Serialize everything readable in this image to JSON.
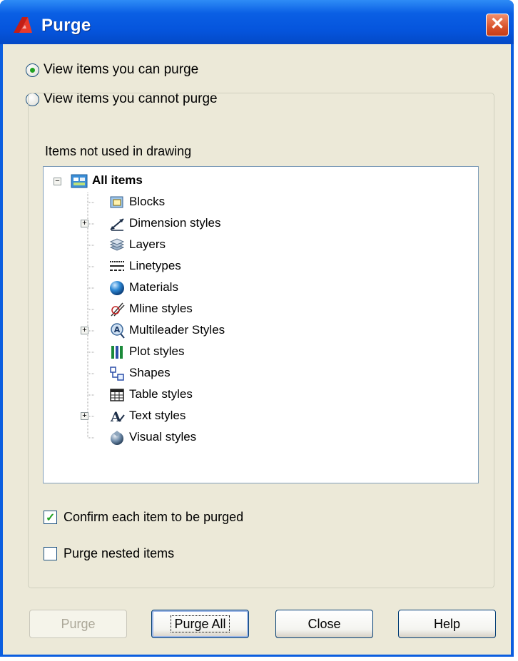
{
  "window": {
    "title": "Purge",
    "close_glyph": "✕",
    "app_icon": "autocad-logo-icon"
  },
  "view_options": [
    {
      "label": "View items you can purge",
      "selected": true
    },
    {
      "label": "View items you cannot purge",
      "selected": false
    }
  ],
  "tree": {
    "group_label": "Items not used in drawing",
    "root": {
      "label": "All items",
      "expanded": true,
      "icon": "all-items-icon"
    },
    "items": [
      {
        "label": "Blocks",
        "icon": "blocks-icon",
        "expandable": false
      },
      {
        "label": "Dimension styles",
        "icon": "dimension-styles-icon",
        "expandable": true
      },
      {
        "label": "Layers",
        "icon": "layers-icon",
        "expandable": false
      },
      {
        "label": "Linetypes",
        "icon": "linetypes-icon",
        "expandable": false
      },
      {
        "label": "Materials",
        "icon": "materials-icon",
        "expandable": false
      },
      {
        "label": "Mline styles",
        "icon": "mline-styles-icon",
        "expandable": false
      },
      {
        "label": "Multileader Styles",
        "icon": "multileader-styles-icon",
        "expandable": true
      },
      {
        "label": "Plot styles",
        "icon": "plot-styles-icon",
        "expandable": false
      },
      {
        "label": "Shapes",
        "icon": "shapes-icon",
        "expandable": false
      },
      {
        "label": "Table styles",
        "icon": "table-styles-icon",
        "expandable": false
      },
      {
        "label": "Text styles",
        "icon": "text-styles-icon",
        "expandable": true
      },
      {
        "label": "Visual styles",
        "icon": "visual-styles-icon",
        "expandable": false
      }
    ]
  },
  "options": {
    "confirm": {
      "label": "Confirm each item to be purged",
      "checked": true
    },
    "nested": {
      "label": "Purge nested items",
      "checked": false
    }
  },
  "buttons": {
    "purge": {
      "label": "Purge",
      "enabled": false
    },
    "purge_all": {
      "label": "Purge All",
      "enabled": true
    },
    "close": {
      "label": "Close",
      "enabled": true
    },
    "help": {
      "label": "Help",
      "enabled": true
    }
  },
  "colors": {
    "titlebar": "#0554dc",
    "close_button": "#d9532c",
    "dialog_face": "#ece9d8",
    "check_mark": "#21a121"
  }
}
